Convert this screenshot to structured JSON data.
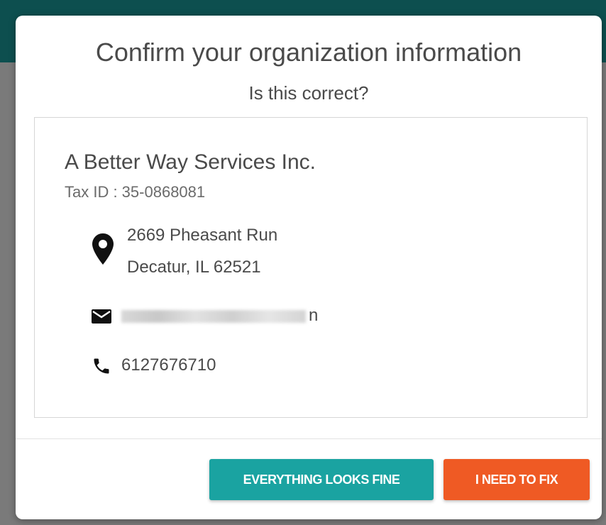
{
  "dialog": {
    "title": "Confirm your organization information",
    "subtitle": "Is this correct?"
  },
  "organization": {
    "name": "A Better Way Services Inc.",
    "tax_id_label": "Tax ID : 35-0868081",
    "address_line1": "2669 Pheasant Run",
    "address_line2": "Decatur, IL 62521",
    "email_visible_tail": "n",
    "phone": "6127676710"
  },
  "icons": {
    "address": "map-marker-icon",
    "email": "envelope-icon",
    "phone": "phone-icon"
  },
  "actions": {
    "confirm_label": "EVERYTHING LOOKS FINE",
    "fix_label": "I NEED TO FIX"
  },
  "colors": {
    "backdrop_header": "#0d4f4f",
    "confirm_button": "#1aa3a1",
    "fix_button": "#ef5a24",
    "text": "#4a4a4a"
  }
}
